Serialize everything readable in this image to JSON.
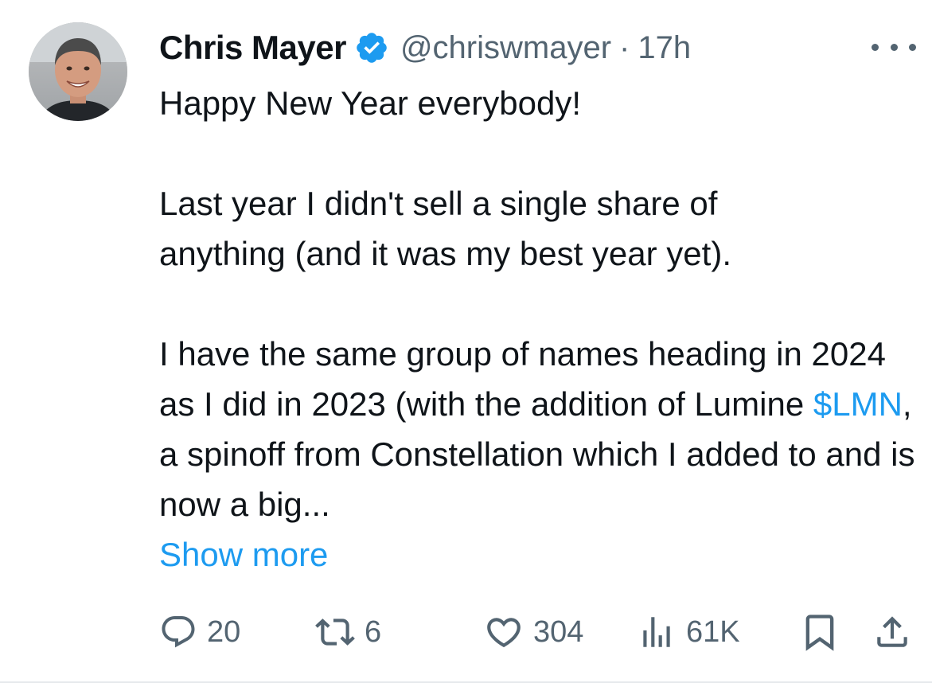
{
  "tweet": {
    "author": {
      "display_name": "Chris Mayer",
      "handle": "@chriswmayer",
      "separator": "·",
      "time": "17h",
      "verified": true,
      "avatar_icon": "profile-photo"
    },
    "more_icon": "ellipsis-icon",
    "text": {
      "line1": "Happy New Year everybody!",
      "para2": "Last year I didn't sell a single share of anything (and it was my best year yet).",
      "para3_before": "I have the same group of names heading in 2024 as I did in 2023 (with the addition of Lumine ",
      "cashtag": "$LMN",
      "para3_after": ", a spinoff from Constellation which I added to and is now a big..."
    },
    "show_more": "Show more",
    "actions": {
      "replies": "20",
      "reposts": "6",
      "likes": "304",
      "views": "61K"
    },
    "colors": {
      "accent": "#1d9bf0",
      "text": "#0f1419",
      "secondary": "#536471"
    }
  }
}
